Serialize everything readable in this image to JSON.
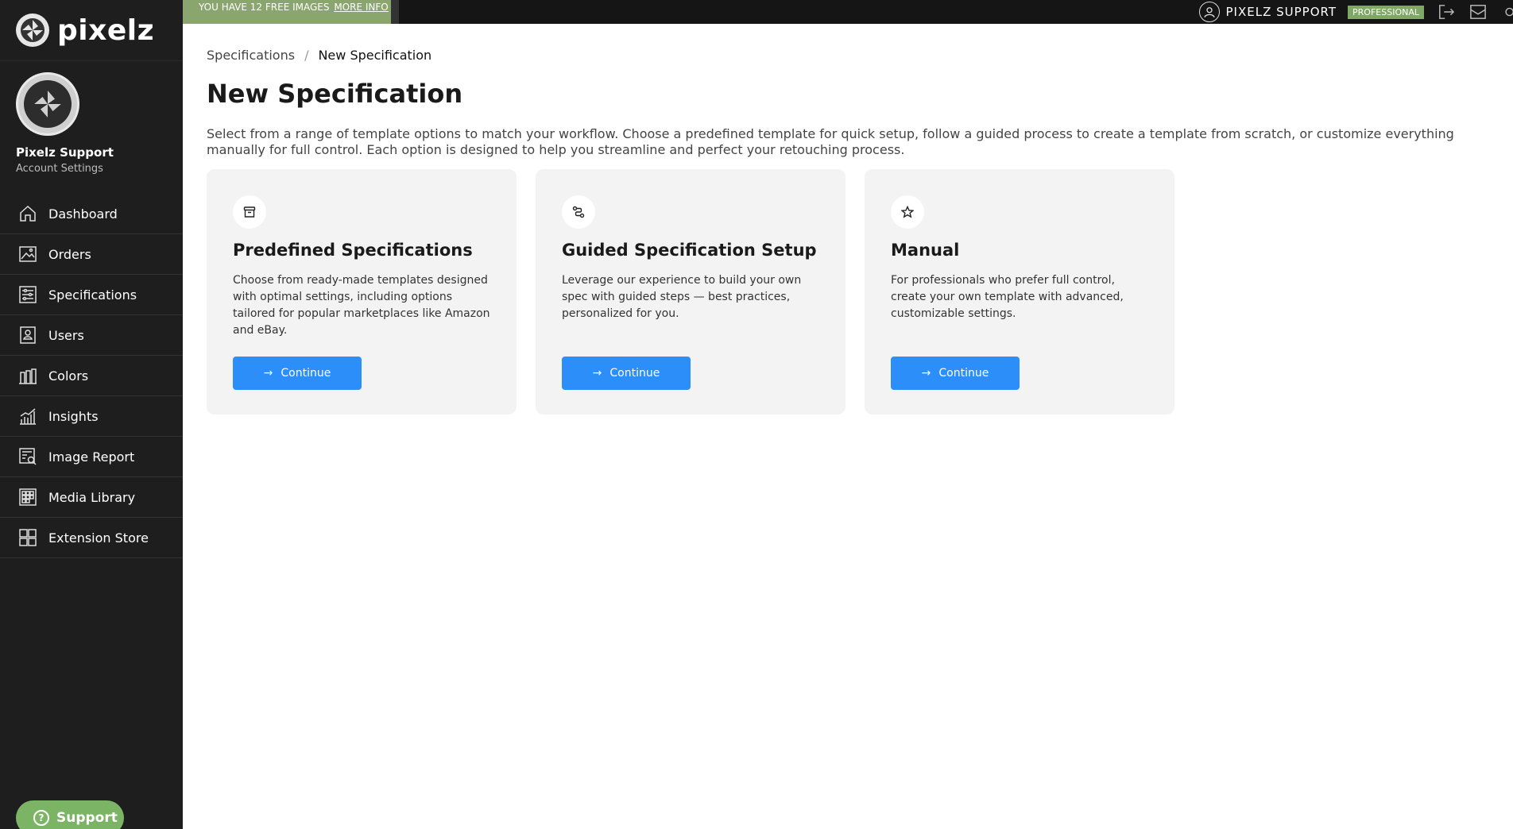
{
  "brand": {
    "name": "pixelz"
  },
  "profile": {
    "name": "Pixelz Support",
    "subtitle": "Account Settings"
  },
  "nav": [
    {
      "label": "Dashboard",
      "icon": "home-icon"
    },
    {
      "label": "Orders",
      "icon": "image-icon"
    },
    {
      "label": "Specifications",
      "icon": "sliders-icon"
    },
    {
      "label": "Users",
      "icon": "user-card-icon"
    },
    {
      "label": "Colors",
      "icon": "swatches-icon"
    },
    {
      "label": "Insights",
      "icon": "chart-icon"
    },
    {
      "label": "Image Report",
      "icon": "report-search-icon"
    },
    {
      "label": "Media Library",
      "icon": "grid-icon"
    },
    {
      "label": "Extension Store",
      "icon": "apps-icon"
    }
  ],
  "support": {
    "label": "Support"
  },
  "topbar": {
    "promo_text": "YOU HAVE 12 FREE IMAGES",
    "promo_link": "MORE INFO",
    "user_name": "PIXELZ SUPPORT",
    "plan": "PROFESSIONAL"
  },
  "breadcrumb": {
    "parent": "Specifications",
    "separator": "/",
    "current": "New Specification"
  },
  "page": {
    "title": "New Specification",
    "description": "Select from a range of template options to match your workflow. Choose a predefined template for quick setup, follow a guided process to create a template from scratch, or customize everything manually for full control. Each option is designed to help you streamline and perfect your retouching process."
  },
  "cards": [
    {
      "icon": "archive-box-icon",
      "title": "Predefined Specifications",
      "description": "Choose from ready-made templates designed with optimal settings, including options tailored for popular marketplaces like Amazon and eBay.",
      "button": "Continue"
    },
    {
      "icon": "route-icon",
      "title": "Guided Specification Setup",
      "description": "Leverage our experience to build your own spec with guided steps — best practices, personalized for you.",
      "button": "Continue"
    },
    {
      "icon": "star-icon",
      "title": "Manual",
      "description": "For professionals who prefer full control, create your own template with advanced, customizable settings.",
      "button": "Continue"
    }
  ],
  "colors": {
    "sidebar": "#1e1e1e",
    "accent_blue": "#2c8ef8",
    "promo_green": "#8aa56e",
    "support_green": "#7cb465"
  }
}
